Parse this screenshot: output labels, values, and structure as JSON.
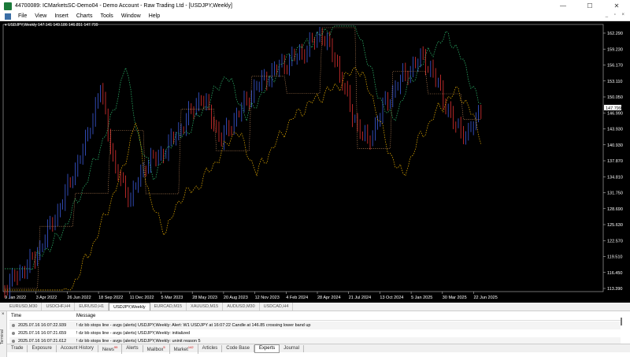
{
  "window": {
    "title": "44700089: ICMarketsSC-Demo04 - Demo Account - Raw Trading Ltd - [USDJPY,Weekly]",
    "minimize": "—",
    "maximize": "☐",
    "close": "✕"
  },
  "menu": {
    "items": [
      "File",
      "View",
      "Insert",
      "Charts",
      "Tools",
      "Window",
      "Help"
    ],
    "right_controls": "_ ▫ ×"
  },
  "chart": {
    "label": "▾ USDJPY,Weekly  147.141 149.186 146.851 147.799",
    "price_labels": [
      "162.290",
      "159.230",
      "156.170",
      "153.110",
      "150.050",
      "147.799",
      "146.990",
      "143.930",
      "140.930",
      "137.870",
      "134.810",
      "131.750",
      "128.690",
      "125.630",
      "122.570",
      "119.510",
      "116.450",
      "113.390"
    ],
    "current_price": "147.799",
    "date_labels": [
      "9 Jan 2022",
      "3 Apr 2022",
      "26 Jun 2022",
      "18 Sep 2022",
      "11 Dec 2022",
      "5 Mar 2023",
      "28 May 2023",
      "20 Aug 2023",
      "12 Nov 2023",
      "4 Feb 2024",
      "28 Apr 2024",
      "21 Jul 2024",
      "13 Oct 2024",
      "5 Jan 2025",
      "30 Mar 2025",
      "22 Jun 2025"
    ],
    "colors": {
      "background": "#000000",
      "bull": "#3b5bdb",
      "bear": "#e03131",
      "upper_band": "#2fbf71",
      "lower_band": "#f0b400",
      "stop_line": "#e8a36a"
    }
  },
  "chart_tabs": {
    "items": [
      "EURUSD,M30",
      "USDCHF,H4",
      "EURUSD,H1",
      "USDJPY,Weekly",
      "EURCAD,M15",
      "XAUUSD,M15",
      "AUDUSD,M30",
      "USDCAD,H4"
    ],
    "active_index": 3
  },
  "terminal": {
    "side_label": "Terminal",
    "close": "×",
    "headers": {
      "time": "Time",
      "message": "Message"
    },
    "rows": [
      {
        "time": "2025.07.16 16:07:22.939",
        "message": "! dz bb stops line - avgs (alerts) USDJPY,Weekly: Alert: W1 USDJPY at 16:07:22 Candle  at 146.85 crossing lower band up"
      },
      {
        "time": "2025.07.16 16:07:21.659",
        "message": "! dz bb stops line - avgs (alerts) USDJPY,Weekly: initialized"
      },
      {
        "time": "2025.07.16 16:07:21.612",
        "message": "! dz bb stops line - avgs (alerts) USDJPY,Weekly: uninit reason 5"
      }
    ],
    "tabs": [
      {
        "label": "Trade",
        "badge": ""
      },
      {
        "label": "Exposure",
        "badge": ""
      },
      {
        "label": "Account History",
        "badge": ""
      },
      {
        "label": "News",
        "badge": "99"
      },
      {
        "label": "Alerts",
        "badge": ""
      },
      {
        "label": "Mailbox",
        "badge": "5"
      },
      {
        "label": "Market",
        "badge": "142"
      },
      {
        "label": "Articles",
        "badge": ""
      },
      {
        "label": "Code Base",
        "badge": ""
      },
      {
        "label": "Experts",
        "badge": ""
      },
      {
        "label": "Journal",
        "badge": ""
      }
    ],
    "active_tab": 9
  }
}
